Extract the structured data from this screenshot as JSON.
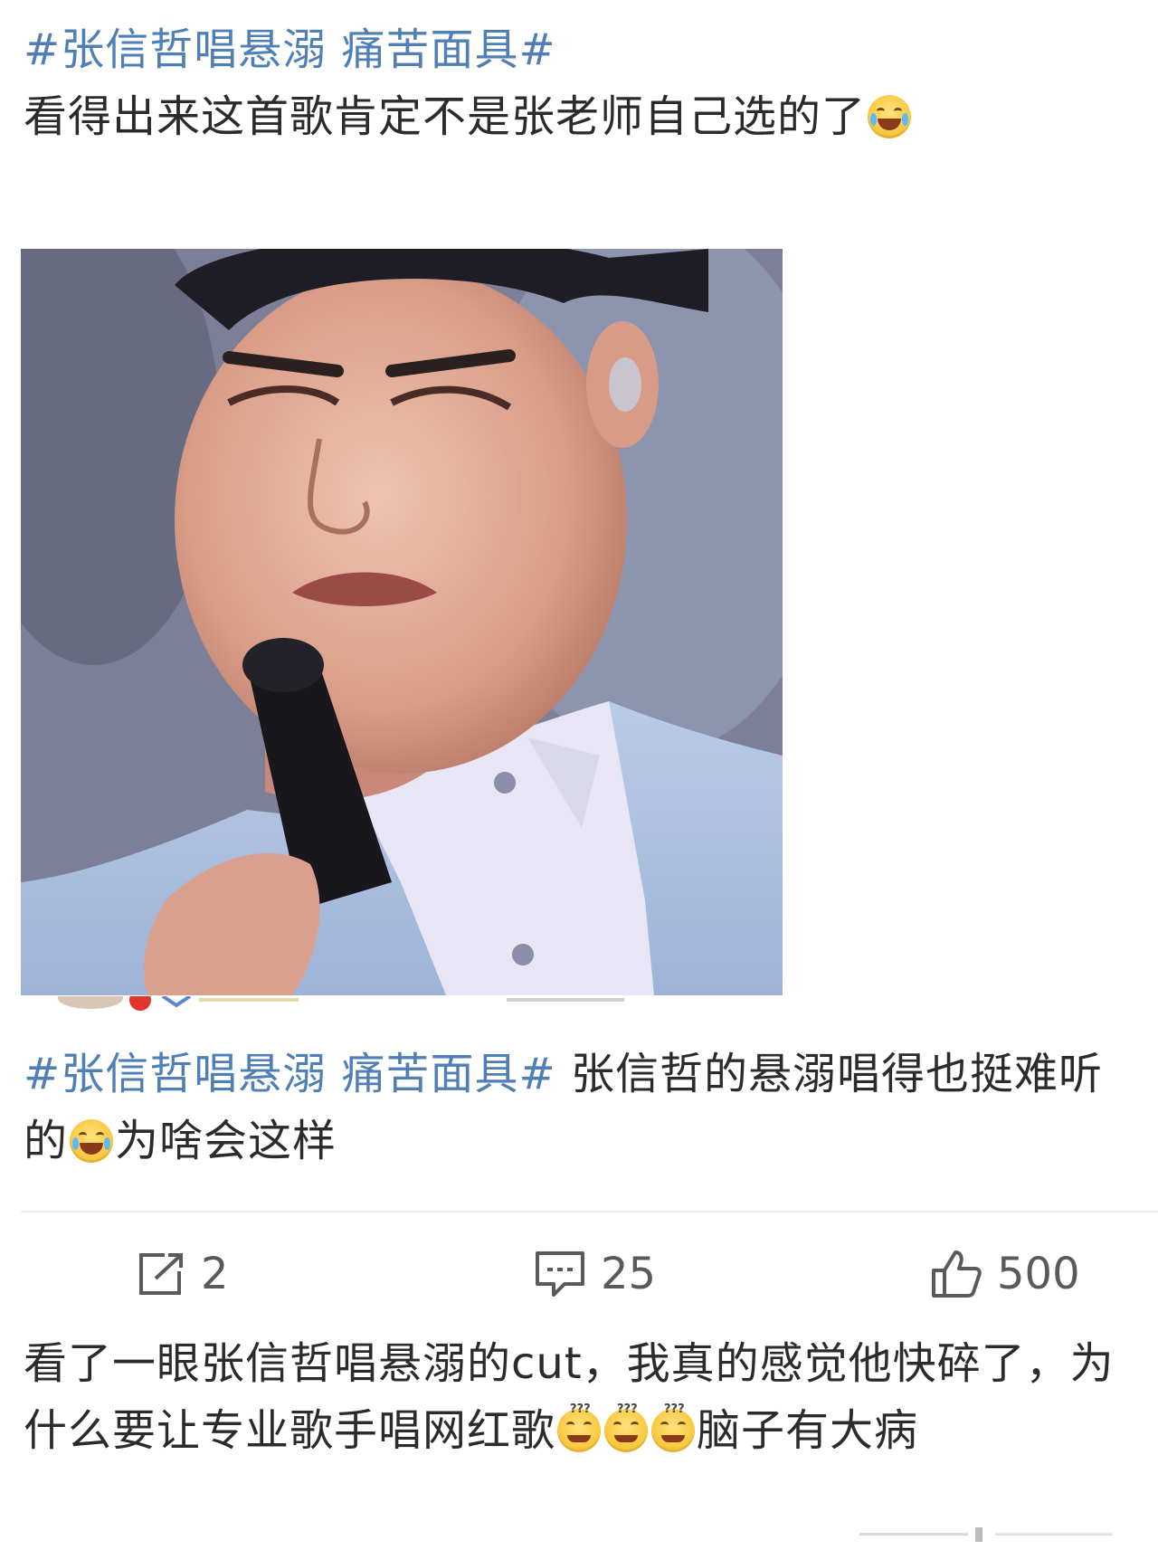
{
  "post1": {
    "hashtag": "#张信哲唱悬溺 痛苦面具#",
    "text": "看得出来这首歌肯定不是张老师自己选的了",
    "emoji": "laugh-cry-emoji"
  },
  "photo": {
    "alt": "singer-closeup-photo"
  },
  "post2": {
    "hashtag": "#张信哲唱悬溺 痛苦面具#",
    "text_a": " 张信哲的悬溺唱得也挺难听的",
    "emoji": "crying-emoji",
    "text_b": "为啥会这样"
  },
  "actions": {
    "repost_count": "2",
    "comment_count": "25",
    "like_count": "500"
  },
  "post3": {
    "text_a": "看了一眼张信哲唱悬溺的cut，我真的感觉他快碎了，为什么要让专业歌手唱网红歌",
    "emojis": [
      "dizzy-emoji",
      "dizzy-emoji",
      "dizzy-emoji"
    ],
    "text_b": "脑子有大病"
  },
  "colors": {
    "hashtag": "#4f7fb5",
    "text": "#2b2b2b",
    "action": "#5a5a5a"
  }
}
